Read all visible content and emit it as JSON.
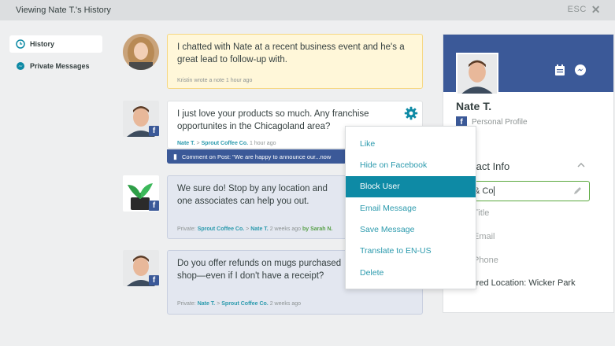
{
  "window": {
    "title": "Viewing Nate T.'s History",
    "esc_label": "ESC"
  },
  "sidebar": {
    "items": [
      {
        "label": "History",
        "icon": "clock-icon",
        "active": true
      },
      {
        "label": "Private Messages",
        "icon": "messenger-icon",
        "active": false
      }
    ]
  },
  "messages": [
    {
      "type": "note",
      "text": "I chatted with Nate at a recent business event and he's a great lead to follow-up with.",
      "meta_author": "Kristin",
      "meta_rest": "wrote a note 1 hour ago"
    },
    {
      "type": "facebook",
      "text": "I just love your products so much. Any franchise opportunites in the Chicagoland area?",
      "meta_from": "Nate T.",
      "meta_sep": ">",
      "meta_to": "Sprout Coffee Co.",
      "meta_time": "1 hour ago",
      "comment": "Comment on Post: \"We are happy to announce our...now"
    },
    {
      "type": "private",
      "text": "We sure do! Stop by any location and one associates can help you out.",
      "meta_prefix": "Private:",
      "meta_from": "Sprout Coffee Co.",
      "meta_sep": ">",
      "meta_to": "Nate T.",
      "meta_time": "2 weeks ago",
      "meta_by": "by Sarah N."
    },
    {
      "type": "private",
      "text": "Do you offer refunds on mugs purchased shop—even if I don't have a receipt?",
      "meta_prefix": "Private:",
      "meta_from": "Nate T.",
      "meta_sep": ">",
      "meta_to": "Sprout Coffee Co.",
      "meta_time": "2 weeks ago"
    }
  ],
  "menu": {
    "items": [
      {
        "label": "Like",
        "active": false
      },
      {
        "label": "Hide on Facebook",
        "active": false
      },
      {
        "label": "Block User",
        "active": true
      },
      {
        "label": "Email Message",
        "active": false
      },
      {
        "label": "Save Message",
        "active": false
      },
      {
        "label": "Translate to EN-US",
        "active": false
      },
      {
        "label": "Delete",
        "active": false
      }
    ]
  },
  "profile": {
    "name": "Nate T.",
    "subtitle": "Personal Profile",
    "section_title": "tact Info",
    "company_value": "& Co",
    "title_placeholder": "Title",
    "email_placeholder": "Email",
    "phone_placeholder": "Phone",
    "location": "rred Location: Wicker Park"
  },
  "colors": {
    "facebook_blue": "#3b5998",
    "accent_teal": "#0e8aa5",
    "link_teal": "#2b9aad",
    "note_bg": "#fff7d9",
    "private_bg": "#e3e7f0",
    "edit_green": "#5aa83d"
  }
}
